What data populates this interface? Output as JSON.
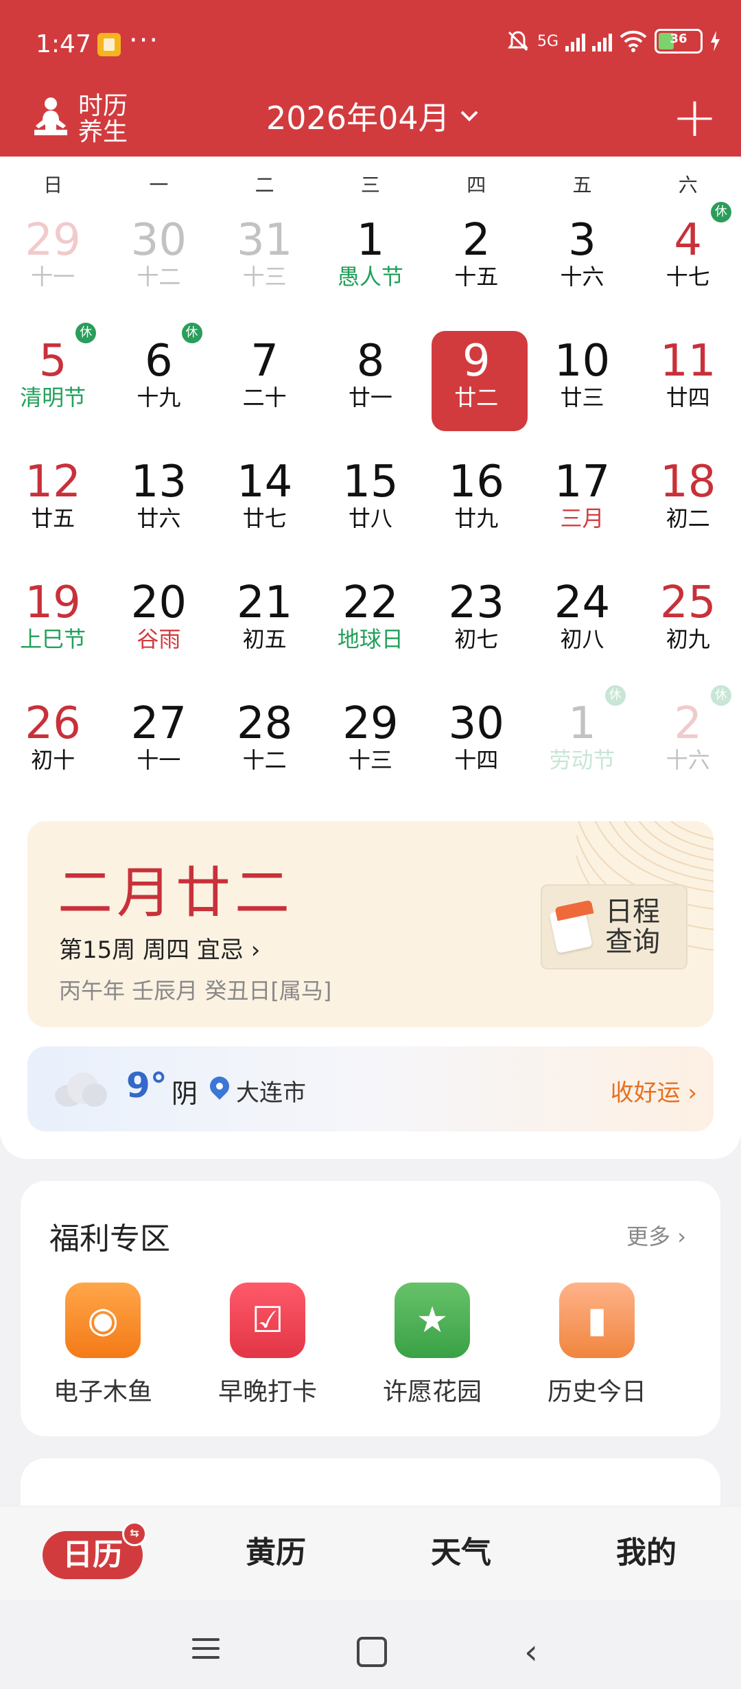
{
  "status": {
    "time": "1:47",
    "dots": "···",
    "network": "5G",
    "battery": "36"
  },
  "header": {
    "logo_line1": "时历",
    "logo_line2": "养生",
    "month_title": "2026年04月"
  },
  "weekdays": [
    "日",
    "一",
    "二",
    "三",
    "四",
    "五",
    "六"
  ],
  "calendar": {
    "weeks": [
      [
        {
          "n": "29",
          "s": "十一",
          "dim": true
        },
        {
          "n": "30",
          "s": "十二",
          "dim": true
        },
        {
          "n": "31",
          "s": "十三",
          "dim": true
        },
        {
          "n": "1",
          "s": "愚人节",
          "sc": "green"
        },
        {
          "n": "2",
          "s": "十五"
        },
        {
          "n": "3",
          "s": "十六"
        },
        {
          "n": "4",
          "s": "十七",
          "rest": "休"
        }
      ],
      [
        {
          "n": "5",
          "s": "清明节",
          "sc": "green",
          "rest": "休"
        },
        {
          "n": "6",
          "s": "十九",
          "rest": "休"
        },
        {
          "n": "7",
          "s": "二十"
        },
        {
          "n": "8",
          "s": "廿一"
        },
        {
          "n": "9",
          "s": "廿二",
          "today": true
        },
        {
          "n": "10",
          "s": "廿三"
        },
        {
          "n": "11",
          "s": "廿四"
        }
      ],
      [
        {
          "n": "12",
          "s": "廿五"
        },
        {
          "n": "13",
          "s": "廿六"
        },
        {
          "n": "14",
          "s": "廿七"
        },
        {
          "n": "15",
          "s": "廿八"
        },
        {
          "n": "16",
          "s": "廿九"
        },
        {
          "n": "17",
          "s": "三月",
          "sc": "red"
        },
        {
          "n": "18",
          "s": "初二"
        }
      ],
      [
        {
          "n": "19",
          "s": "上巳节",
          "sc": "green"
        },
        {
          "n": "20",
          "s": "谷雨",
          "sc": "red"
        },
        {
          "n": "21",
          "s": "初五"
        },
        {
          "n": "22",
          "s": "地球日",
          "sc": "green"
        },
        {
          "n": "23",
          "s": "初七"
        },
        {
          "n": "24",
          "s": "初八"
        },
        {
          "n": "25",
          "s": "初九"
        }
      ],
      [
        {
          "n": "26",
          "s": "初十"
        },
        {
          "n": "27",
          "s": "十一"
        },
        {
          "n": "28",
          "s": "十二"
        },
        {
          "n": "29",
          "s": "十三"
        },
        {
          "n": "30",
          "s": "十四"
        },
        {
          "n": "1",
          "s": "劳动节",
          "sc": "green",
          "dim": true,
          "rest": "休"
        },
        {
          "n": "2",
          "s": "十六",
          "dim": true,
          "rest": "休"
        }
      ]
    ]
  },
  "lunar": {
    "date": "二月廿二",
    "week_line": "第15周 周四 宜忌",
    "ganzhi": "丙午年 壬辰月 癸丑日[属马]",
    "schedule_l1": "日程",
    "schedule_l2": "查询"
  },
  "weather": {
    "temp": "9°",
    "condition": "阴",
    "city": "大连市",
    "luck": "收好运"
  },
  "welfare": {
    "title": "福利专区",
    "more": "更多",
    "apps": [
      {
        "label": "电子木鱼",
        "icon": "wooden-fish-icon"
      },
      {
        "label": "早晚打卡",
        "icon": "checkin-calendar-icon"
      },
      {
        "label": "许愿花园",
        "icon": "wish-jar-icon"
      },
      {
        "label": "历史今日",
        "icon": "history-scroll-icon"
      }
    ]
  },
  "tabs": [
    "日历",
    "黄历",
    "天气",
    "我的"
  ],
  "colors": {
    "brand_red": "#d23b3e",
    "holiday_green": "#21a05a",
    "weather_blue": "#3468c9",
    "luck_orange": "#e8701e"
  }
}
